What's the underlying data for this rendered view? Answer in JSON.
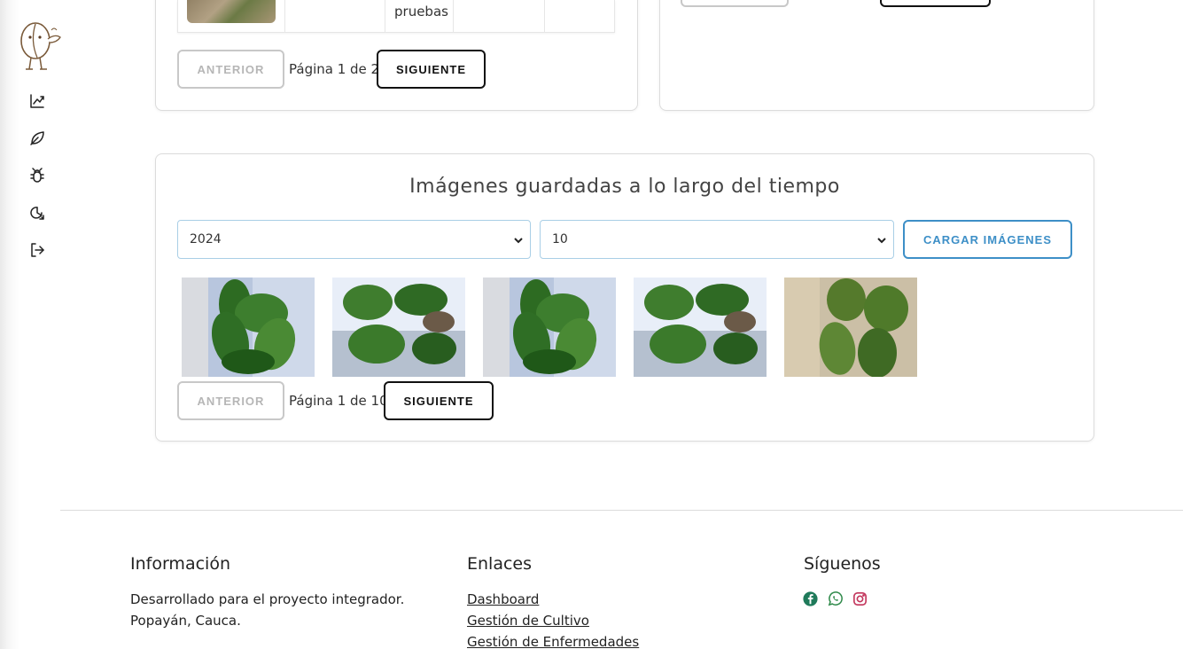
{
  "sidebar": {
    "logo": "coffee-bean-mascot-logo",
    "items": [
      {
        "icon": "chart-line-icon"
      },
      {
        "icon": "leaf-icon"
      },
      {
        "icon": "bug-icon"
      },
      {
        "icon": "disease-cycle-icon"
      },
      {
        "icon": "logout-icon"
      }
    ]
  },
  "table_card": {
    "cell_text": "pruebas",
    "pagination": {
      "prev": "ANTERIOR",
      "label": "Página 1 de 2",
      "next": "SIGUIENTE"
    }
  },
  "gallery": {
    "title": "Imágenes guardadas a lo largo del tiempo",
    "year_select": {
      "value": "2024"
    },
    "month_select": {
      "value": "10"
    },
    "load_button": "CARGAR IMÁGENES",
    "image_count": 5,
    "pagination": {
      "prev": "ANTERIOR",
      "label": "Página 1 de 10",
      "next": "SIGUIENTE"
    }
  },
  "footer": {
    "info": {
      "heading": "Información",
      "line1": "Desarrollado para el proyecto integrador.",
      "line2": "Popayán, Cauca."
    },
    "links": {
      "heading": "Enlaces",
      "items": [
        "Dashboard",
        "Gestión de Cultivo",
        "Gestión de Enfermedades"
      ]
    },
    "social": {
      "heading": "Síguenos",
      "icons": [
        "facebook-icon",
        "whatsapp-icon",
        "instagram-icon"
      ]
    }
  },
  "colors": {
    "accent": "#3d8fc7",
    "facebook": "#1f7a5a",
    "whatsapp": "#2f8a4a",
    "instagram": "#c2335a"
  }
}
